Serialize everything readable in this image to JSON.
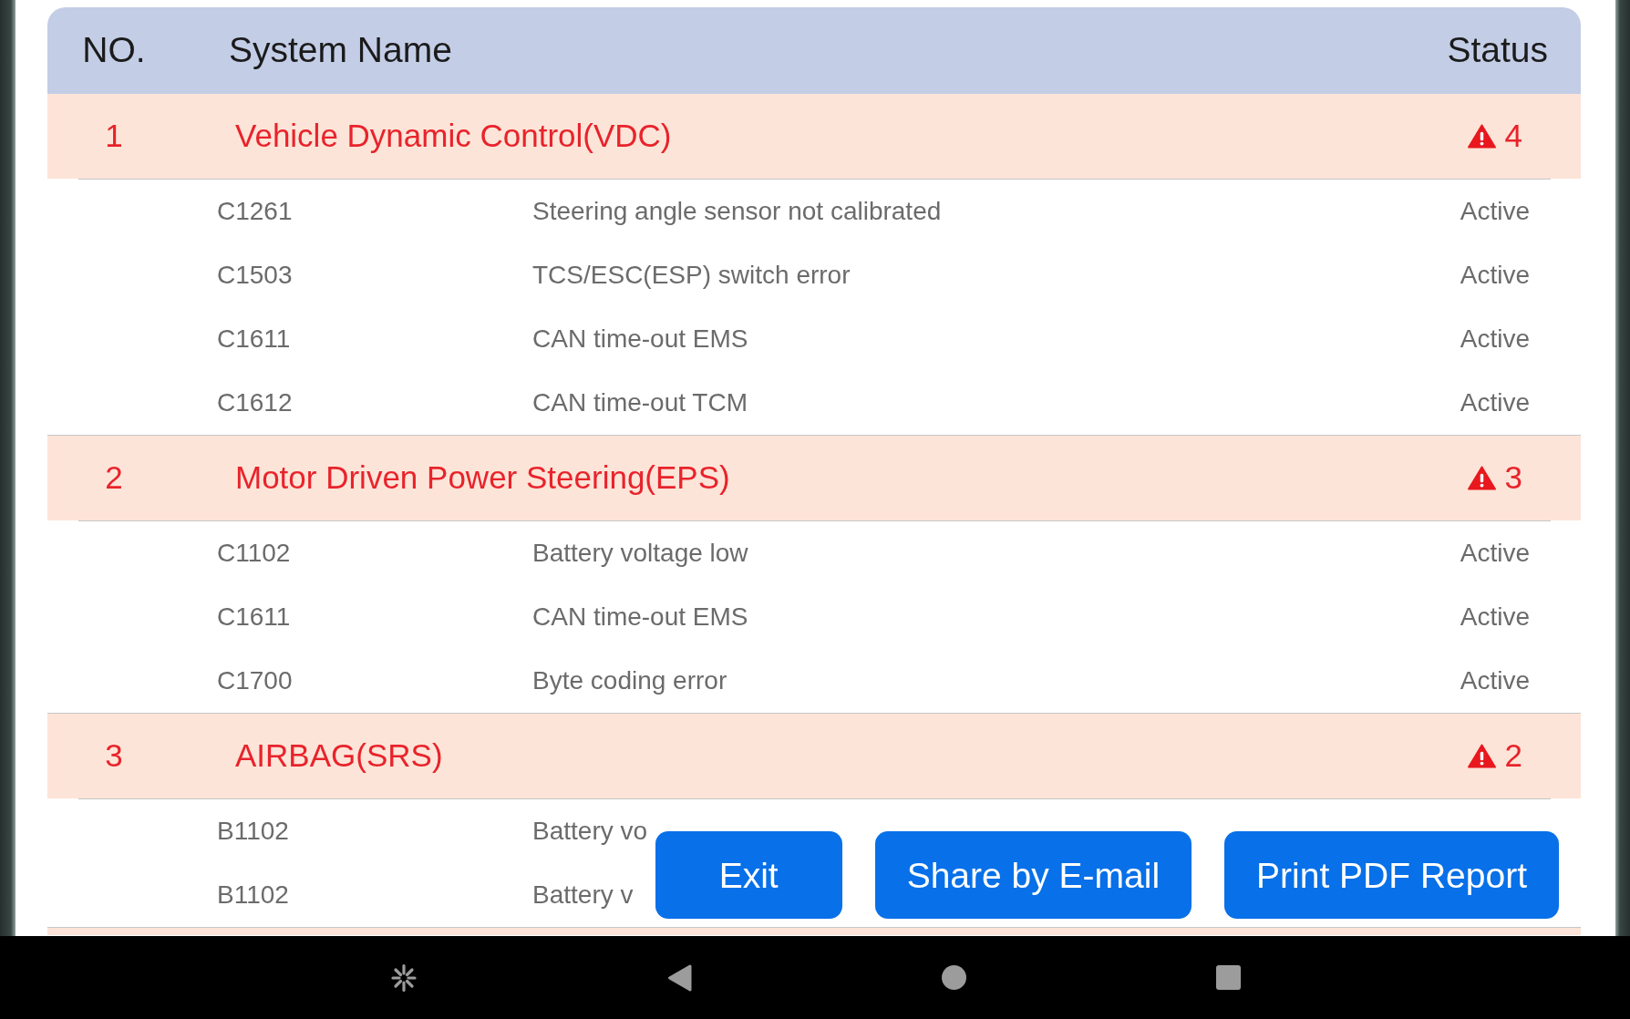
{
  "table": {
    "columns": [
      "NO.",
      "System Name",
      "Status"
    ],
    "groups": [
      {
        "number": "1",
        "name": "Vehicle Dynamic Control(VDC)",
        "fault_count": "4",
        "faults": [
          {
            "code": "C1261",
            "description": "Steering angle sensor not calibrated",
            "status": "Active"
          },
          {
            "code": "C1503",
            "description": "TCS/ESC(ESP) switch error",
            "status": "Active"
          },
          {
            "code": "C1611",
            "description": "CAN time-out EMS",
            "status": "Active"
          },
          {
            "code": "C1612",
            "description": "CAN time-out TCM",
            "status": "Active"
          }
        ]
      },
      {
        "number": "2",
        "name": "Motor Driven Power Steering(EPS)",
        "fault_count": "3",
        "faults": [
          {
            "code": "C1102",
            "description": "Battery voltage low",
            "status": "Active"
          },
          {
            "code": "C1611",
            "description": "CAN time-out EMS",
            "status": "Active"
          },
          {
            "code": "C1700",
            "description": "Byte coding error",
            "status": "Active"
          }
        ]
      },
      {
        "number": "3",
        "name": "AIRBAG(SRS)",
        "fault_count": "2",
        "faults": [
          {
            "code": "B1102",
            "description": "Battery vo"
          },
          {
            "code": "B1102",
            "description": "Battery v"
          }
        ]
      }
    ]
  },
  "buttons": [
    {
      "label": "Exit"
    },
    {
      "label": "Share by E-mail"
    },
    {
      "label": "Print PDF Report"
    }
  ]
}
